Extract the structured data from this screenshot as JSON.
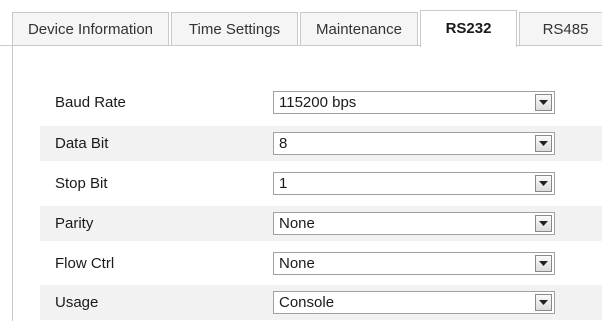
{
  "tabs": [
    {
      "label": "Device Information",
      "active": false
    },
    {
      "label": "Time Settings",
      "active": false
    },
    {
      "label": "Maintenance",
      "active": false
    },
    {
      "label": "RS232",
      "active": true
    },
    {
      "label": "RS485",
      "active": false
    }
  ],
  "form": {
    "rows": [
      {
        "label": "Baud Rate",
        "value": "115200 bps"
      },
      {
        "label": "Data Bit",
        "value": "8"
      },
      {
        "label": "Stop Bit",
        "value": "1"
      },
      {
        "label": "Parity",
        "value": "None"
      },
      {
        "label": "Flow Ctrl",
        "value": "None"
      },
      {
        "label": "Usage",
        "value": "Console"
      }
    ]
  },
  "icons": {
    "dropdown": "chevron-down-icon"
  },
  "colors": {
    "border": "#c8c8c8",
    "row_alt_background": "#f2f2f2",
    "text": "#1a1a1a"
  }
}
